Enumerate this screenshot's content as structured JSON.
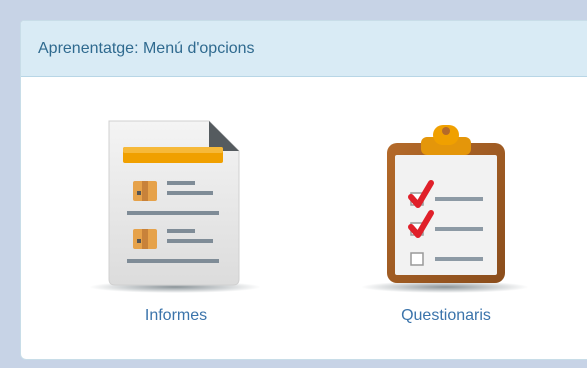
{
  "panel": {
    "title": "Aprenentatge: Menú d'opcions"
  },
  "options": [
    {
      "label": "Informes",
      "icon": "report-document-icon"
    },
    {
      "label": "Questionaris",
      "icon": "clipboard-checklist-icon"
    }
  ],
  "colors": {
    "header_bg": "#d9ebf5",
    "title_text": "#2f6a8f",
    "link_text": "#3b74ab",
    "accent_orange": "#f0a000",
    "check_red": "#e0202a"
  }
}
